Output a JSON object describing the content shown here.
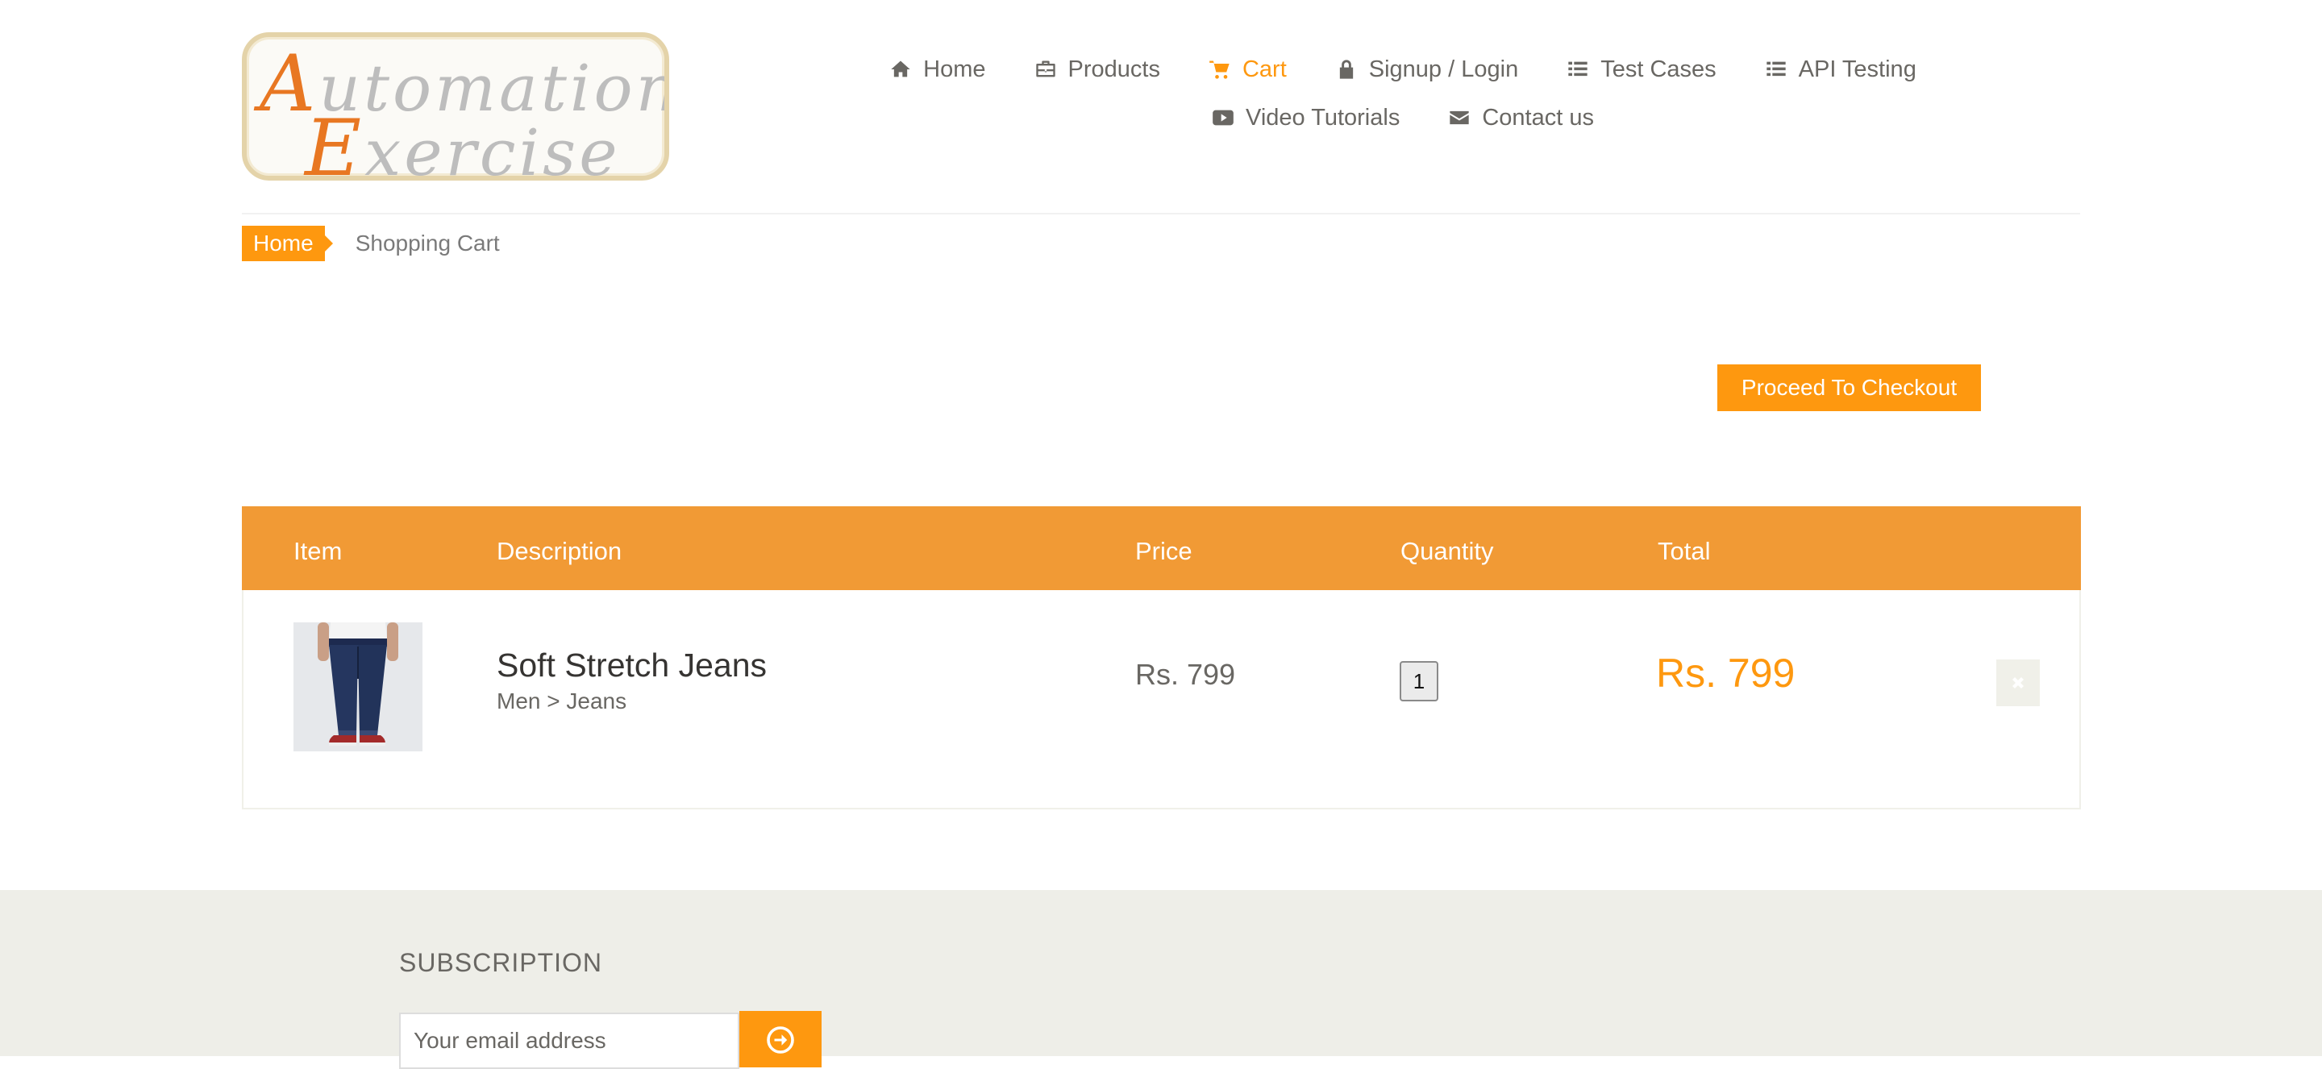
{
  "logo": {
    "line1_cap": "A",
    "line1_rest": "utomation",
    "line2_cap": "E",
    "line2_rest": "xercise"
  },
  "nav": {
    "items": [
      {
        "label": "Home",
        "icon": "home-icon"
      },
      {
        "label": "Products",
        "icon": "briefcase-icon"
      },
      {
        "label": "Cart",
        "icon": "cart-icon",
        "active": true
      },
      {
        "label": "Signup / Login",
        "icon": "lock-icon"
      },
      {
        "label": "Test Cases",
        "icon": "list-icon"
      },
      {
        "label": "API Testing",
        "icon": "list-icon"
      },
      {
        "label": "Video Tutorials",
        "icon": "youtube-play-icon"
      },
      {
        "label": "Contact us",
        "icon": "envelope-icon"
      }
    ]
  },
  "breadcrumb": {
    "home": "Home",
    "current": "Shopping Cart"
  },
  "checkout_button": "Proceed To Checkout",
  "cart": {
    "headers": {
      "item": "Item",
      "description": "Description",
      "price": "Price",
      "quantity": "Quantity",
      "total": "Total"
    },
    "rows": [
      {
        "name": "Soft Stretch Jeans",
        "category": "Men > Jeans",
        "price": "Rs. 799",
        "quantity": "1",
        "total": "Rs. 799",
        "image_icon": "jeans-product-image"
      }
    ]
  },
  "footer": {
    "subscription_title": "SUBSCRIPTION",
    "email_placeholder": "Your email address",
    "subscribe_icon": "arrow-circle-right-icon"
  },
  "colors": {
    "accent": "#fe980f",
    "text": "#696763",
    "footer_bg": "#eeeee8"
  }
}
